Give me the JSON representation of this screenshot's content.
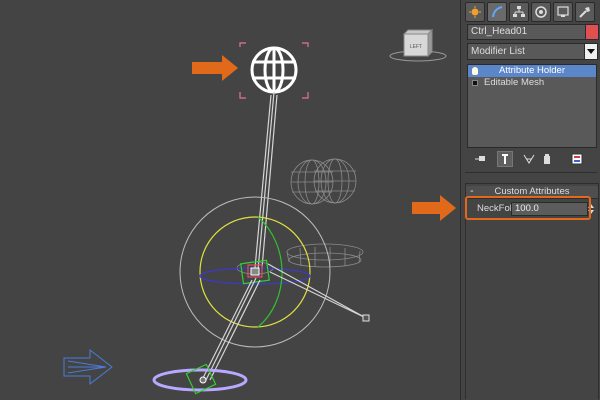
{
  "panel": {
    "object_name": "Ctrl_Head01",
    "object_color": "#e05050",
    "modifier_list_label": "Modifier List",
    "stack_items": [
      {
        "label": "Attribute Holder",
        "selected": true,
        "icon": "bulb-icon"
      },
      {
        "label": "Editable Mesh",
        "selected": false,
        "icon": "mesh-box-icon"
      }
    ],
    "rollout": {
      "minus": "-",
      "title": "Custom Attributes",
      "attribute_label": "NeckFollow:",
      "attribute_value": "100.0"
    },
    "tabs": [
      "create-icon",
      "modify-icon",
      "hierarchy-icon",
      "motion-icon",
      "display-icon",
      "utilities-icon"
    ],
    "stack_tools": [
      "pin-stack-icon",
      "show-end-result-icon",
      "make-unique-icon",
      "remove-modifier-icon",
      "configure-modifier-sets-icon"
    ]
  },
  "viewport": {
    "viewcube_label": "LEFT"
  },
  "colors": {
    "accent_orange": "#e06a1a",
    "selection_blue": "#5b86c9",
    "viewport_bg": "#444444"
  }
}
